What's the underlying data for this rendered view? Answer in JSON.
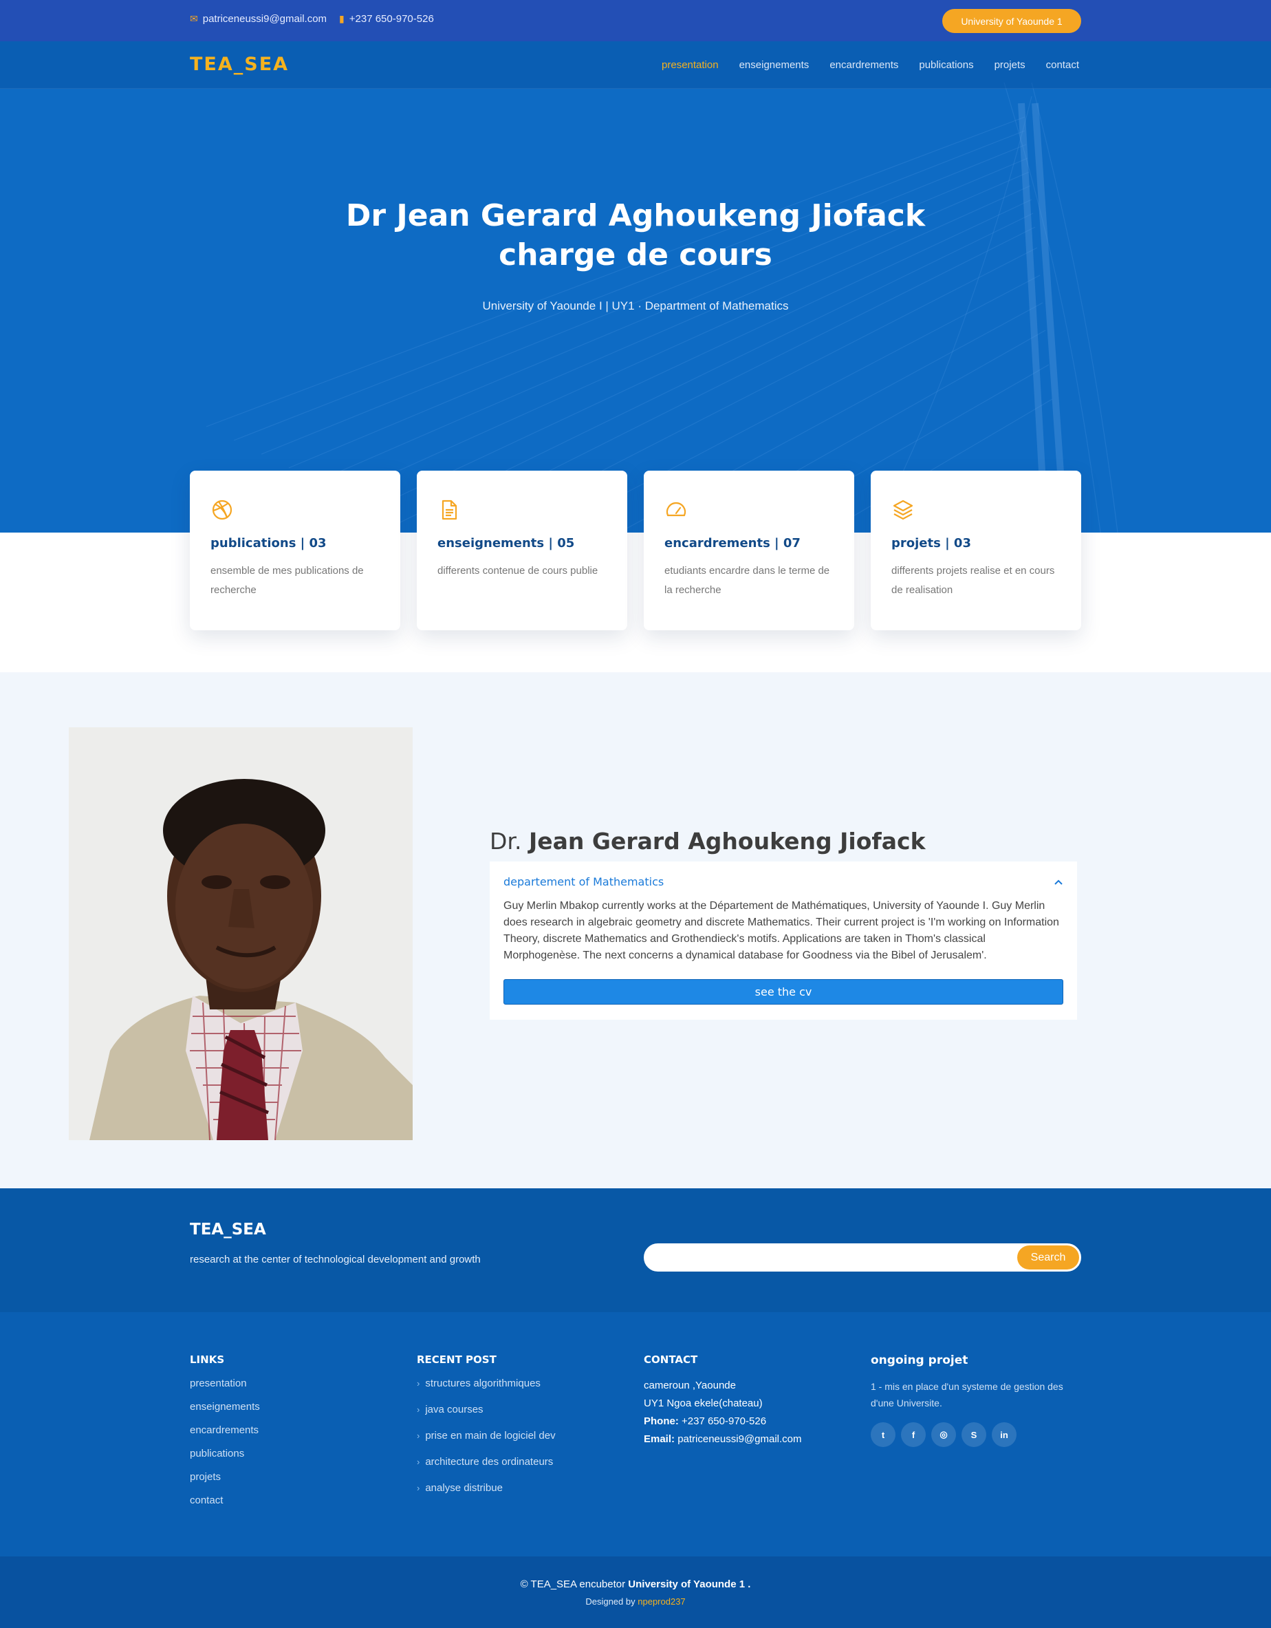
{
  "topbar": {
    "email": "patriceneussi9@gmail.com",
    "phone": "+237 650-970-526",
    "university_button": "University of Yaounde 1",
    "email_icon": "envelope-icon",
    "phone_icon": "phone-icon"
  },
  "navbar": {
    "logo": "TEA_SEA",
    "items": [
      {
        "label": "presentation",
        "active": true
      },
      {
        "label": "enseignements"
      },
      {
        "label": "encardrements"
      },
      {
        "label": "publications"
      },
      {
        "label": "projets"
      },
      {
        "label": "contact"
      }
    ]
  },
  "hero": {
    "title_line1": "Dr Jean Gerard Aghoukeng Jiofack",
    "title_line2": "charge de cours",
    "subtitle": "University of Yaounde I | UY1 · Department of Mathematics"
  },
  "cards": [
    {
      "icon": "dribbble-icon",
      "title": "publications | 03",
      "text": "ensemble de mes publications de recherche"
    },
    {
      "icon": "document-icon",
      "title": "enseignements | 05",
      "text": "differents contenue de cours publie"
    },
    {
      "icon": "speedometer-icon",
      "title": "encardrements | 07",
      "text": "etudiants encardre dans le terme de la recherche"
    },
    {
      "icon": "layers-icon",
      "title": "projets | 03",
      "text": "differents projets realise et en cours de realisation"
    }
  ],
  "about": {
    "name_prefix": "Dr.",
    "name": "Jean Gerard Aghoukeng Jiofack",
    "accordion_title": "departement of Mathematics",
    "accordion_body": "Guy Merlin Mbakop currently works at the Département de Mathématiques, University of Yaounde I. Guy Merlin does research in algebraic geometry and discrete Mathematics. Their current project is 'I'm working on Information Theory, discrete Mathematics and Grothendieck's motifs. Applications are taken in Thom's classical Morphogenèse. The next concerns a dynamical database for Goodness via the Bibel of Jerusalem'.",
    "cv_button": "see the cv"
  },
  "newsletter": {
    "brand": "TEA_SEA",
    "tagline": "research at the center of technological development and growth",
    "search_placeholder": "",
    "search_button": "Search"
  },
  "footer": {
    "links_title": "LINKS",
    "links": [
      "presentation",
      "enseignements",
      "encardrements",
      "publications",
      "projets",
      "contact"
    ],
    "posts_title": "RECENT POST",
    "posts": [
      "structures algorithmiques",
      "java courses",
      "prise en main de logiciel dev",
      "architecture des ordinateurs",
      "analyse distribue"
    ],
    "contact_title": "CONTACT",
    "contact_line1": "cameroun ,Yaounde",
    "contact_line2": "UY1 Ngoa ekele(chateau)",
    "phone_label": "Phone:",
    "phone": "+237 650-970-526",
    "email_label": "Email:",
    "email": "patriceneussi9@gmail.com",
    "project_title": "ongoing projet",
    "project_text": "1 - mis en place d'un systeme de gestion des d'une Universite.",
    "social": [
      {
        "icon": "twitter-icon",
        "glyph": "t"
      },
      {
        "icon": "facebook-icon",
        "glyph": "f"
      },
      {
        "icon": "instagram-icon",
        "glyph": "◎"
      },
      {
        "icon": "skype-icon",
        "glyph": "S"
      },
      {
        "icon": "linkedin-icon",
        "glyph": "in"
      }
    ]
  },
  "copyright": {
    "prefix": "© TEA_SEA encubetor",
    "org": "University of Yaounde 1 .",
    "designed_by": "Designed by",
    "designer": "npeprod237"
  },
  "colors": {
    "topbar": "#234fb5",
    "hero": "#0e6bc4",
    "accent": "#f5a623",
    "card_title": "#124a88",
    "footer": "#0a5fb3"
  }
}
